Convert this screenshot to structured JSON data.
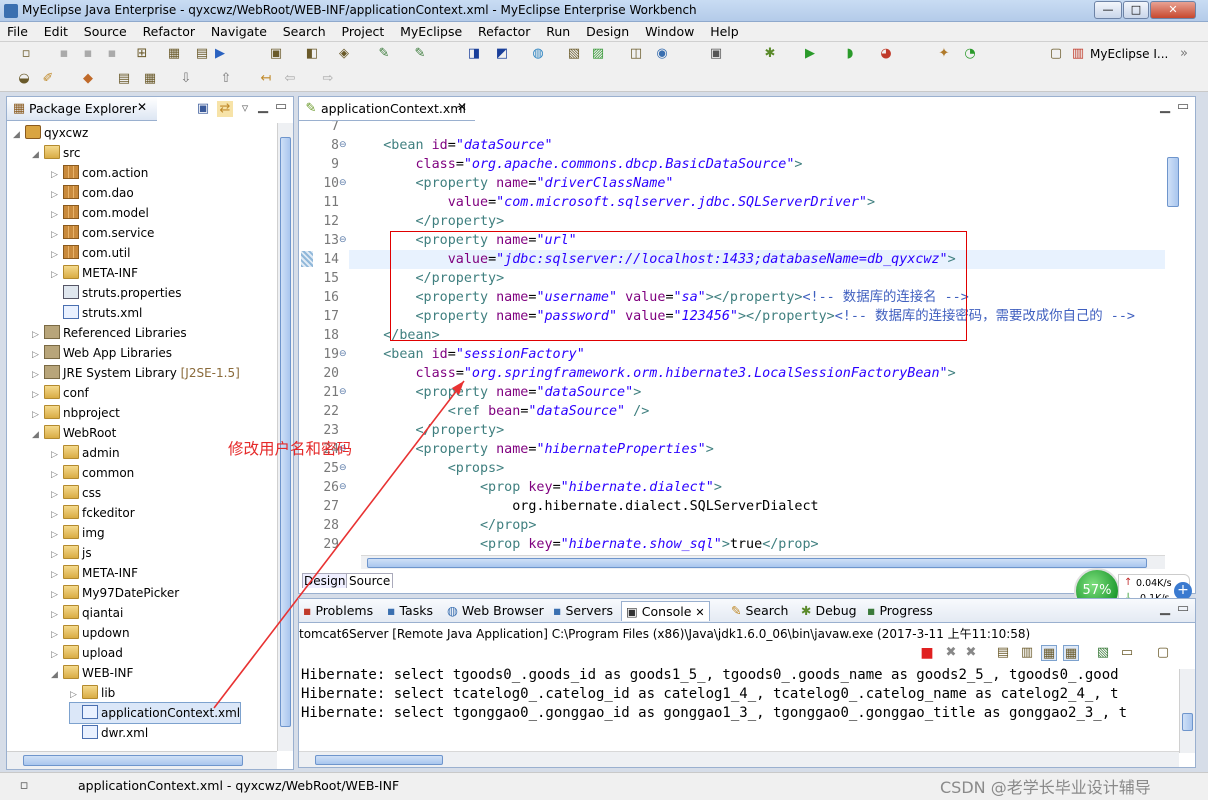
{
  "window": {
    "title": "MyEclipse Java Enterprise - qyxcwz/WebRoot/WEB-INF/applicationContext.xml - MyEclipse Enterprise Workbench",
    "min": "—",
    "max": "□",
    "close": "✕"
  },
  "menu": [
    "File",
    "Edit",
    "Source",
    "Refactor",
    "Navigate",
    "Search",
    "Project",
    "MyEclipse",
    "Refactor",
    "Run",
    "Design",
    "Window",
    "Help"
  ],
  "perspective": {
    "label": "MyEclipse I..."
  },
  "package_explorer": {
    "title": "Package Explorer",
    "items": [
      {
        "label": "qyxcwz",
        "icon": "project-icon",
        "depth": 0,
        "open": true
      },
      {
        "label": "src",
        "icon": "source-folder-icon",
        "depth": 1,
        "open": true
      },
      {
        "label": "com.action",
        "icon": "package-icon",
        "depth": 2
      },
      {
        "label": "com.dao",
        "icon": "package-icon",
        "depth": 2
      },
      {
        "label": "com.model",
        "icon": "package-icon",
        "depth": 2
      },
      {
        "label": "com.service",
        "icon": "package-icon",
        "depth": 2
      },
      {
        "label": "com.util",
        "icon": "package-icon",
        "depth": 2
      },
      {
        "label": "META-INF",
        "icon": "folder-icon",
        "depth": 2
      },
      {
        "label": "struts.properties",
        "icon": "properties-file-icon",
        "depth": 2,
        "leaf": true
      },
      {
        "label": "struts.xml",
        "icon": "xml-file-icon",
        "depth": 2,
        "leaf": true
      },
      {
        "label": "Referenced Libraries",
        "icon": "library-icon",
        "depth": 1
      },
      {
        "label": "Web App Libraries",
        "icon": "library-icon",
        "depth": 1
      },
      {
        "label": "JRE System Library",
        "suffix": "[J2SE-1.5]",
        "icon": "library-icon",
        "depth": 1
      },
      {
        "label": "conf",
        "icon": "folder-icon",
        "depth": 1
      },
      {
        "label": "nbproject",
        "icon": "folder-icon",
        "depth": 1
      },
      {
        "label": "WebRoot",
        "icon": "web-folder-icon",
        "depth": 1,
        "open": true
      },
      {
        "label": "admin",
        "icon": "folder-icon",
        "depth": 2
      },
      {
        "label": "common",
        "icon": "folder-icon",
        "depth": 2
      },
      {
        "label": "css",
        "icon": "folder-icon",
        "depth": 2
      },
      {
        "label": "fckeditor",
        "icon": "folder-icon",
        "depth": 2
      },
      {
        "label": "img",
        "icon": "folder-icon",
        "depth": 2
      },
      {
        "label": "js",
        "icon": "folder-icon",
        "depth": 2
      },
      {
        "label": "META-INF",
        "icon": "folder-icon",
        "depth": 2
      },
      {
        "label": "My97DatePicker",
        "icon": "folder-icon",
        "depth": 2
      },
      {
        "label": "qiantai",
        "icon": "folder-icon",
        "depth": 2
      },
      {
        "label": "updown",
        "icon": "folder-icon",
        "depth": 2
      },
      {
        "label": "upload",
        "icon": "folder-icon",
        "depth": 2
      },
      {
        "label": "WEB-INF",
        "icon": "folder-icon",
        "depth": 2,
        "open": true
      },
      {
        "label": "lib",
        "icon": "folder-icon",
        "depth": 3
      },
      {
        "label": "applicationContext.xml",
        "icon": "spring-xml-icon",
        "depth": 3,
        "leaf": true,
        "selected": true
      },
      {
        "label": "dwr.xml",
        "icon": "xml-file-icon",
        "depth": 3,
        "leaf": true
      }
    ]
  },
  "editor": {
    "tab": "applicationContext.xml",
    "lines": [
      {
        "n": "7",
        "t": []
      },
      {
        "n": "8",
        "fold": true,
        "t": [
          [
            "tg",
            "    <bean "
          ],
          [
            "an",
            "id"
          ],
          [
            "tx",
            "="
          ],
          [
            "av",
            "\"dataSource\""
          ]
        ]
      },
      {
        "n": "9",
        "t": [
          [
            "an",
            "        class"
          ],
          [
            "tx",
            "="
          ],
          [
            "av",
            "\"org.apache.commons.dbcp.BasicDataSource\""
          ],
          [
            "tg",
            ">"
          ]
        ]
      },
      {
        "n": "10",
        "fold": true,
        "t": [
          [
            "tg",
            "        <property "
          ],
          [
            "an",
            "name"
          ],
          [
            "tx",
            "="
          ],
          [
            "av",
            "\"driverClassName\""
          ]
        ]
      },
      {
        "n": "11",
        "t": [
          [
            "an",
            "            value"
          ],
          [
            "tx",
            "="
          ],
          [
            "av",
            "\"com.microsoft.sqlserver.jdbc.SQLServerDriver\""
          ],
          [
            "tg",
            ">"
          ]
        ]
      },
      {
        "n": "12",
        "t": [
          [
            "tg",
            "        </property>"
          ]
        ]
      },
      {
        "n": "13",
        "fold": true,
        "t": [
          [
            "tg",
            "        <property "
          ],
          [
            "an",
            "name"
          ],
          [
            "tx",
            "="
          ],
          [
            "av",
            "\"url\""
          ]
        ]
      },
      {
        "n": "14",
        "cur": true,
        "t": [
          [
            "an",
            "            value"
          ],
          [
            "tx",
            "="
          ],
          [
            "av",
            "\"jdbc:sqlserver://localhost:1433;databaseName=db_qyxcwz\""
          ],
          [
            "tg",
            ">"
          ]
        ]
      },
      {
        "n": "15",
        "t": [
          [
            "tg",
            "        </property>"
          ]
        ]
      },
      {
        "n": "16",
        "t": [
          [
            "tg",
            "        <property "
          ],
          [
            "an",
            "name"
          ],
          [
            "tx",
            "="
          ],
          [
            "av",
            "\"username\""
          ],
          [
            "tx",
            " "
          ],
          [
            "an",
            "value"
          ],
          [
            "tx",
            "="
          ],
          [
            "av",
            "\"sa\""
          ],
          [
            "tg",
            "></property>"
          ],
          [
            "cm",
            "<!-- 数据库的连接名 -->"
          ]
        ]
      },
      {
        "n": "17",
        "t": [
          [
            "tg",
            "        <property "
          ],
          [
            "an",
            "name"
          ],
          [
            "tx",
            "="
          ],
          [
            "av",
            "\"password\""
          ],
          [
            "tx",
            " "
          ],
          [
            "an",
            "value"
          ],
          [
            "tx",
            "="
          ],
          [
            "av",
            "\"123456\""
          ],
          [
            "tg",
            "></property>"
          ],
          [
            "cm",
            "<!-- 数据库的连接密码，需要改成你自己的 -->"
          ]
        ]
      },
      {
        "n": "18",
        "t": [
          [
            "tg",
            "    </bean>"
          ]
        ]
      },
      {
        "n": "19",
        "fold": true,
        "t": [
          [
            "tg",
            "    <bean "
          ],
          [
            "an",
            "id"
          ],
          [
            "tx",
            "="
          ],
          [
            "av",
            "\"sessionFactory\""
          ]
        ]
      },
      {
        "n": "20",
        "t": [
          [
            "an",
            "        class"
          ],
          [
            "tx",
            "="
          ],
          [
            "av",
            "\"org.springframework.orm.hibernate3.LocalSessionFactoryBean\""
          ],
          [
            "tg",
            ">"
          ]
        ]
      },
      {
        "n": "21",
        "fold": true,
        "t": [
          [
            "tg",
            "        <property "
          ],
          [
            "an",
            "name"
          ],
          [
            "tx",
            "="
          ],
          [
            "av",
            "\"dataSource\""
          ],
          [
            "tg",
            ">"
          ]
        ]
      },
      {
        "n": "22",
        "t": [
          [
            "tg",
            "            <ref "
          ],
          [
            "an",
            "bean"
          ],
          [
            "tx",
            "="
          ],
          [
            "av",
            "\"dataSource\""
          ],
          [
            "tg",
            " />"
          ]
        ]
      },
      {
        "n": "23",
        "t": [
          [
            "tg",
            "        </property>"
          ]
        ]
      },
      {
        "n": "24",
        "fold": true,
        "t": [
          [
            "tg",
            "        <property "
          ],
          [
            "an",
            "name"
          ],
          [
            "tx",
            "="
          ],
          [
            "av",
            "\"hibernateProperties\""
          ],
          [
            "tg",
            ">"
          ]
        ]
      },
      {
        "n": "25",
        "fold": true,
        "t": [
          [
            "tg",
            "            <props>"
          ]
        ]
      },
      {
        "n": "26",
        "fold": true,
        "t": [
          [
            "tg",
            "                <prop "
          ],
          [
            "an",
            "key"
          ],
          [
            "tx",
            "="
          ],
          [
            "av",
            "\"hibernate.dialect\""
          ],
          [
            "tg",
            ">"
          ]
        ]
      },
      {
        "n": "27",
        "t": [
          [
            "tx",
            "                    org.hibernate.dialect.SQLServerDialect"
          ]
        ]
      },
      {
        "n": "28",
        "t": [
          [
            "tg",
            "                </prop>"
          ]
        ]
      },
      {
        "n": "29",
        "t": [
          [
            "tg",
            "                <prop "
          ],
          [
            "an",
            "key"
          ],
          [
            "tx",
            "="
          ],
          [
            "av",
            "\"hibernate.show_sql\""
          ],
          [
            "tg",
            ">"
          ],
          [
            "tx",
            "true"
          ],
          [
            "tg",
            "</prop>"
          ]
        ]
      }
    ],
    "design_tab": "Design",
    "source_tab": "Source"
  },
  "annotation": {
    "text": "修改用户名和密码",
    "color": "#e52a2a"
  },
  "bottom_tabs": [
    "Problems",
    "Tasks",
    "Web Browser",
    "Servers",
    "Console",
    "Search",
    "Debug",
    "Progress"
  ],
  "console": {
    "header": "tomcat6Server [Remote Java Application] C:\\Program Files (x86)\\Java\\jdk1.6.0_06\\bin\\javaw.exe (2017-3-11 上午11:10:58)",
    "lines": [
      "Hibernate: select tgoods0_.goods_id as goods1_5_, tgoods0_.goods_name as goods2_5_, tgoods0_.good",
      "Hibernate: select tcatelog0_.catelog_id as catelog1_4_, tcatelog0_.catelog_name as catelog2_4_, t",
      "Hibernate: select tgonggao0_.gonggao_id as gonggao1_3_, tgonggao0_.gonggao_title as gonggao2_3_, t"
    ]
  },
  "network": {
    "percent": "57%",
    "up": "0.04K/s",
    "down": "0.1K/s"
  },
  "status": {
    "path": "applicationContext.xml - qyxcwz/WebRoot/WEB-INF"
  },
  "watermark": "CSDN @老学长毕业设计辅导"
}
